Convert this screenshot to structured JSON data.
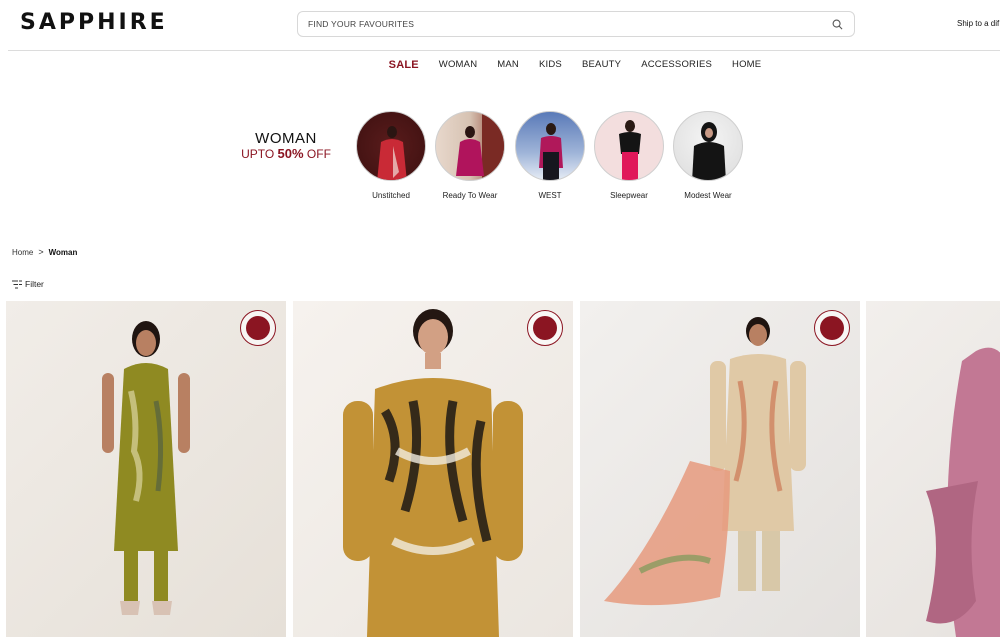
{
  "header": {
    "logo": "SAPPHIRE",
    "search_placeholder": "FIND YOUR FAVOURITES",
    "ship_text": "Ship to a dif"
  },
  "nav": {
    "items": [
      "SALE",
      "WOMAN",
      "MAN",
      "KIDS",
      "BEAUTY",
      "ACCESSORIES",
      "HOME"
    ]
  },
  "promo": {
    "line1": "WOMAN",
    "line2_prefix": "UPTO ",
    "line2_bold": "50%",
    "line2_suffix": " OFF"
  },
  "categories": [
    {
      "label": "Unstitched"
    },
    {
      "label": "Ready To Wear"
    },
    {
      "label": "WEST"
    },
    {
      "label": "Sleepwear"
    },
    {
      "label": "Modest Wear"
    }
  ],
  "breadcrumb": {
    "home": "Home",
    "separator": ">",
    "current": "Woman"
  },
  "filter": {
    "label": "Filter"
  },
  "products": [
    {
      "has_badge": true
    },
    {
      "has_badge": true
    },
    {
      "has_badge": true
    },
    {
      "has_badge": false
    }
  ],
  "colors": {
    "accent": "#8b1522",
    "text": "#222222",
    "border": "#dcdcdc"
  }
}
